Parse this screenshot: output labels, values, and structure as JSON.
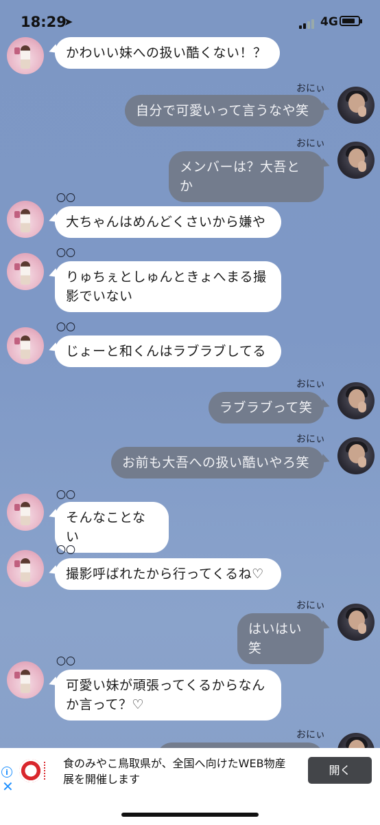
{
  "status_bar": {
    "time": "18:29",
    "location_icon": "location-arrow-icon",
    "network": "4G",
    "battery_level": 0.8
  },
  "colors": {
    "background": "#7e98c6",
    "bubble_incoming": "#ffffff",
    "bubble_outgoing": "#737c8d",
    "ad_button": "#434549",
    "ad_icons": "#1e90ff"
  },
  "messages": [
    {
      "side": "left",
      "sender": "",
      "text": "かわいい妹への扱い酷くない！？"
    },
    {
      "side": "right",
      "sender": "おにぃ",
      "text": "自分で可愛いって言うなや笑"
    },
    {
      "side": "right",
      "sender": "おにぃ",
      "text": "メンバーは？大吾とか"
    },
    {
      "side": "left",
      "sender": "〇〇",
      "text": "大ちゃんはめんどくさいから嫌や"
    },
    {
      "side": "left",
      "sender": "〇〇",
      "text": "りゅちぇとしゅんときょへまる撮影でいない"
    },
    {
      "side": "left",
      "sender": "〇〇",
      "text": "じょーと和くんはラブラブしてる"
    },
    {
      "side": "right",
      "sender": "おにぃ",
      "text": "ラブラブって笑"
    },
    {
      "side": "right",
      "sender": "おにぃ",
      "text": "お前も大吾への扱い酷いやろ笑"
    },
    {
      "side": "left",
      "sender": "〇〇",
      "text": "そんなことない"
    },
    {
      "side": "left",
      "sender": "〇〇",
      "text": "撮影呼ばれたから行ってくるね♡"
    },
    {
      "side": "right",
      "sender": "おにぃ",
      "text": "はいはい笑"
    },
    {
      "side": "left",
      "sender": "〇〇",
      "text": "可愛い妹が頑張ってくるからなんか言って？♡"
    },
    {
      "side": "right",
      "sender": "おにぃ",
      "text": ""
    }
  ],
  "ad": {
    "info_icon": "info-icon",
    "close_icon": "close-icon",
    "text": "食のみやこ鳥取県が、全国へ向けたWEB物産展を開催します",
    "button_label": "開く"
  }
}
